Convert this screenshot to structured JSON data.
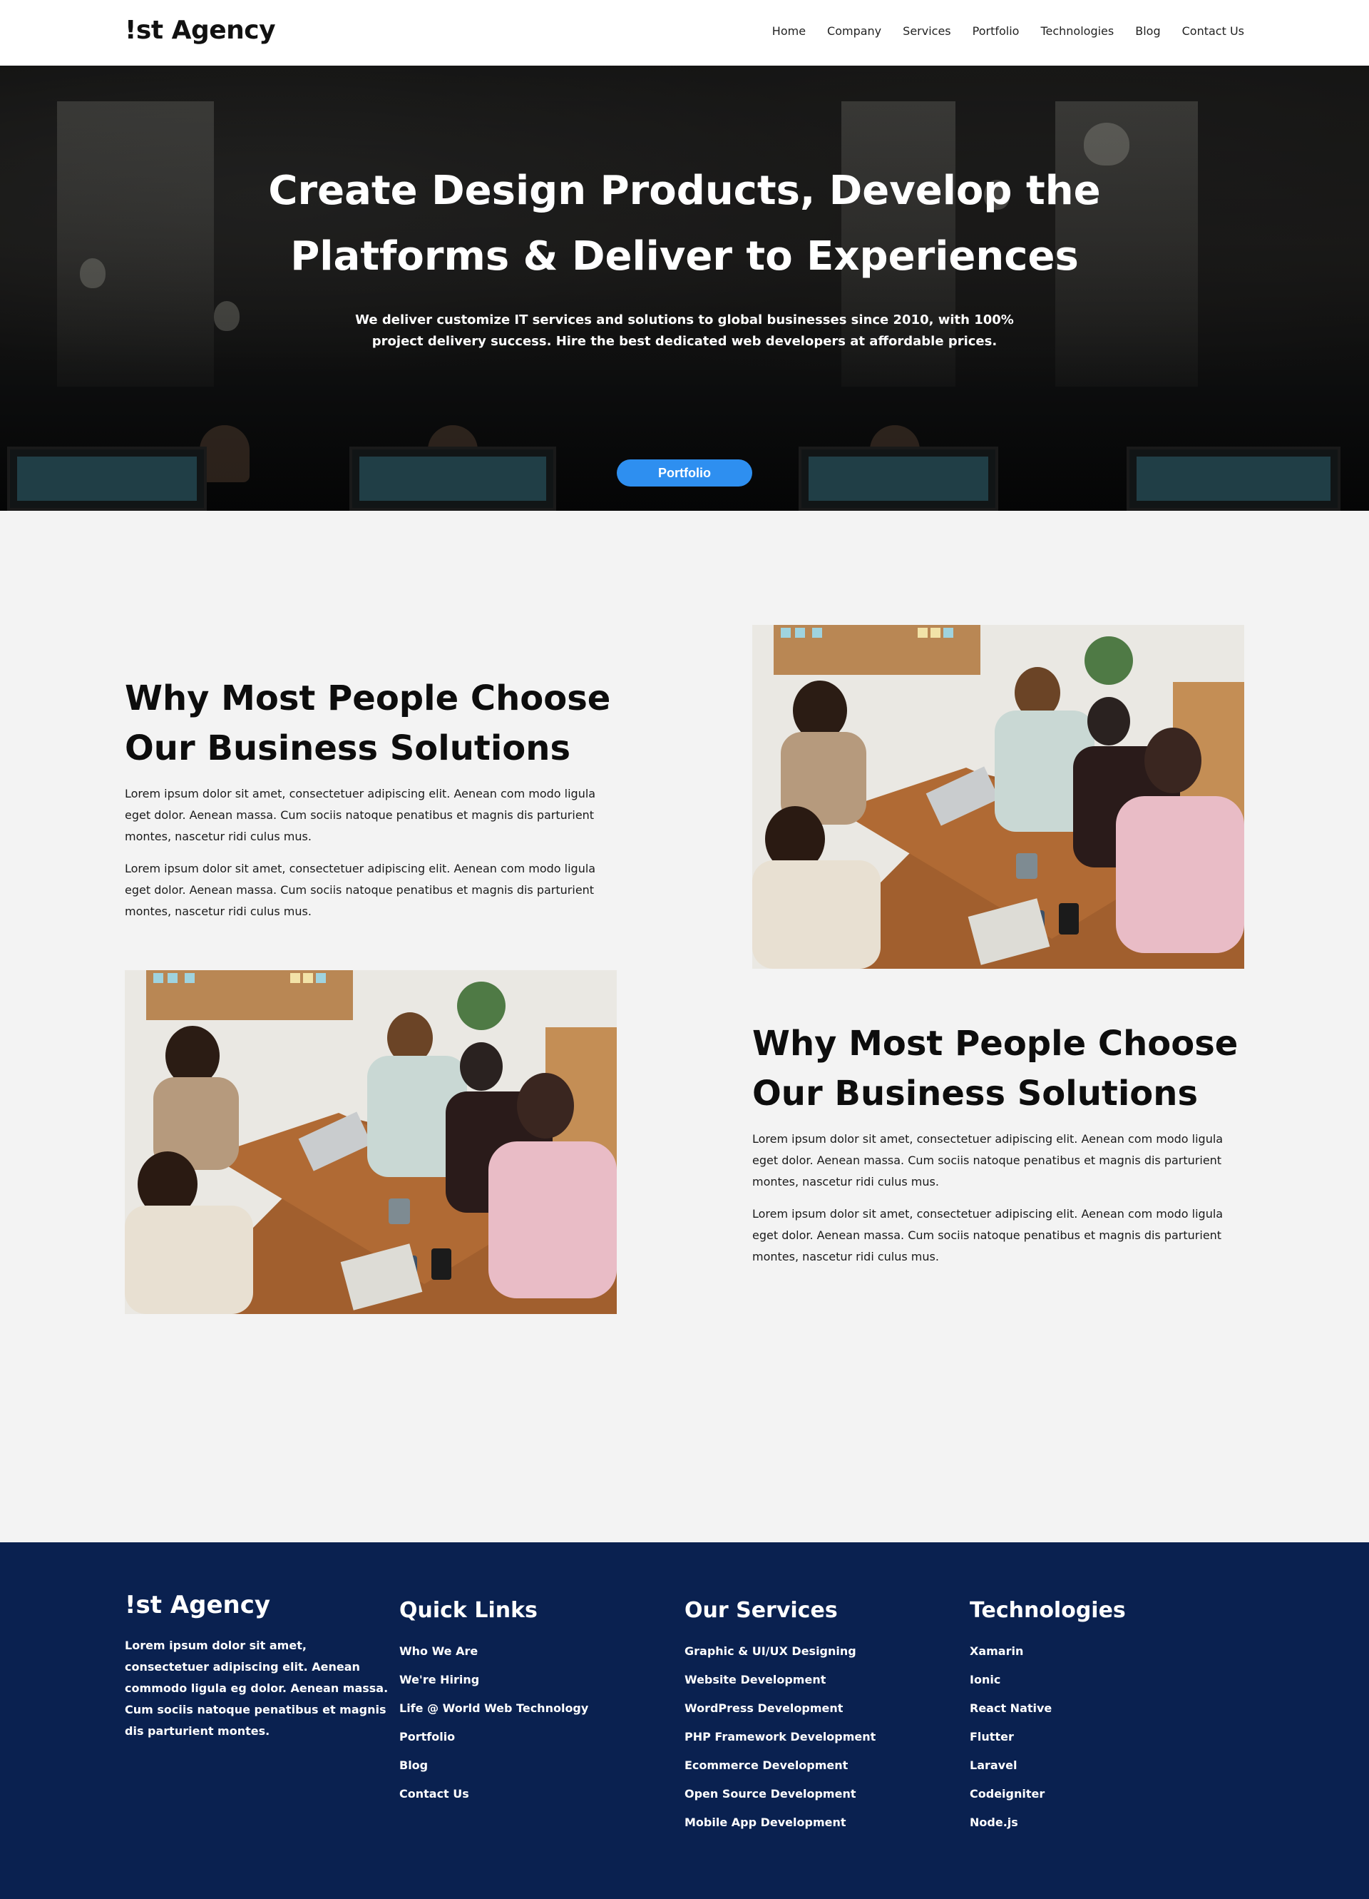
{
  "header": {
    "logo": "!st Agency",
    "nav": [
      "Home",
      "Company",
      "Services",
      "Portfolio",
      "Technologies",
      "Blog",
      "Contact Us"
    ]
  },
  "hero": {
    "title_line1": "Create Design Products, Develop the",
    "title_line2": "Platforms & Deliver to Experiences",
    "subtitle_line1": "We deliver customize IT services and solutions to global businesses since 2010, with 100%",
    "subtitle_line2": "project delivery success. Hire the best dedicated web developers at affordable prices.",
    "button": "Portfolio"
  },
  "sections": [
    {
      "heading_line1": "Why Most People Choose",
      "heading_line2": "Our Business Solutions",
      "para1": "Lorem ipsum dolor sit amet, consectetuer adipiscing elit. Aenean com modo ligula eget dolor. Aenean massa. Cum sociis natoque penatibus et magnis dis parturient montes, nascetur ridi culus mus.",
      "para2": "Lorem ipsum dolor sit amet, consectetuer adipiscing elit. Aenean com modo ligula eget dolor. Aenean massa. Cum sociis natoque penatibus et magnis dis parturient montes, nascetur ridi culus mus."
    },
    {
      "heading_line1": "Why Most People Choose",
      "heading_line2": "Our Business Solutions",
      "para1": "Lorem ipsum dolor sit amet, consectetuer adipiscing elit. Aenean com modo ligula eget dolor. Aenean massa. Cum sociis natoque penatibus et magnis dis parturient montes, nascetur ridi culus mus.",
      "para2": "Lorem ipsum dolor sit amet, consectetuer adipiscing elit. Aenean com modo ligula eget dolor. Aenean massa. Cum sociis natoque penatibus et magnis dis parturient montes, nascetur ridi culus mus."
    }
  ],
  "footer": {
    "logo": "!st Agency",
    "about": "Lorem ipsum dolor sit amet, consectetuer adipiscing elit. Aenean commodo ligula eg dolor. Aenean massa. Cum sociis natoque penatibus et magnis dis parturient montes.",
    "quick_links": {
      "title": "Quick Links",
      "items": [
        "Who We Are",
        "We're Hiring",
        "Life @ World Web Technology",
        "Portfolio",
        "Blog",
        "Contact Us"
      ]
    },
    "services": {
      "title": "Our Services",
      "items": [
        "Graphic & UI/UX Designing",
        "Website Development",
        "WordPress Development",
        "PHP Framework Development",
        "Ecommerce Development",
        "Open Source Development",
        "Mobile App Development"
      ]
    },
    "technologies": {
      "title": "Technologies",
      "items": [
        "Xamarin",
        "Ionic",
        "React Native",
        "Flutter",
        "Laravel",
        "Codeigniter",
        "Node.js"
      ]
    }
  },
  "colors": {
    "accent": "#2e8ff0",
    "footer_bg": "#0a2150",
    "page_bg": "#f3f3f3"
  }
}
